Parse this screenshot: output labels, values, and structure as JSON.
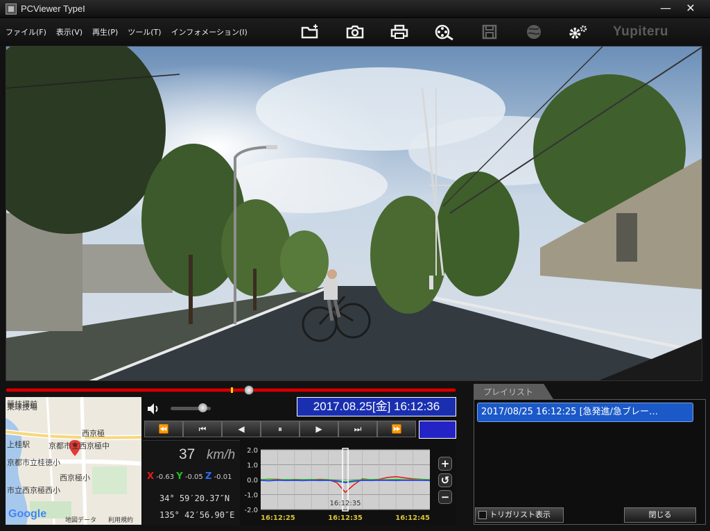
{
  "window": {
    "title": "PCViewer TypeI",
    "minimize_label": "—",
    "close_label": "✕"
  },
  "menu": [
    {
      "label": "ファイル(F)"
    },
    {
      "label": "表示(V)"
    },
    {
      "label": "再生(P)"
    },
    {
      "label": "ツール(T)"
    },
    {
      "label": "インフォメーション(I)"
    }
  ],
  "toolbar": {
    "icons": [
      "folder-icon",
      "camera-icon",
      "print-icon",
      "film-search-icon",
      "save-icon",
      "globe-icon",
      "settings-icon"
    ],
    "brand": "Yupiteru"
  },
  "seek": {
    "progress": 0.54,
    "marker": 0.5
  },
  "volume": {
    "level": 0.8
  },
  "datetime": "2017.08.25[金] 16:12:36",
  "playback_buttons": [
    "⏪",
    "⏮",
    "◀",
    "⏸",
    "▶",
    "⏭",
    "⏩"
  ],
  "colors": {
    "accent_blue": "#1a2fb0",
    "seek_red": "#d40000",
    "playlist_blue": "#1b59c8"
  },
  "map": {
    "labels": [
      "競技場前",
      "東球技場",
      "西京極",
      "上桂駅",
      "京都市立西京極中",
      "京都市立桂徳小",
      "西京極小",
      "市立西京極西小",
      "地図データ",
      "利用規約"
    ],
    "attribution": "Google"
  },
  "info": {
    "speed": "37",
    "speed_unit": "km/h",
    "x_label": "X",
    "x_value": "-0.63",
    "y_label": "Y",
    "y_value": "-0.05",
    "z_label": "Z",
    "z_value": "-0.01",
    "latitude": "34° 59′20.37″N",
    "longitude": "135° 42′56.90″E"
  },
  "chart_data": {
    "type": "line",
    "title": "",
    "xlabel": "",
    "ylabel": "",
    "ylim": [
      -2.0,
      2.0
    ],
    "yticks": [
      "2.0",
      "1.0",
      "0.0",
      "-1.0",
      "-2.0"
    ],
    "xticks": [
      "16:12:25",
      "16:12:35",
      "16:12:45"
    ],
    "cursor_label": "16:12:35",
    "x": [
      0,
      5,
      10,
      15,
      20,
      25,
      30,
      35,
      40,
      45,
      50,
      55,
      60,
      65,
      70,
      75,
      80,
      85,
      90,
      95,
      100
    ],
    "series": [
      {
        "color": "#e41b1b",
        "values": [
          0.0,
          0.03,
          0.02,
          -0.02,
          0.01,
          0.0,
          -0.01,
          0.02,
          0.0,
          -0.2,
          -0.85,
          -0.35,
          0.05,
          0.0,
          0.02,
          0.15,
          0.2,
          0.12,
          0.05,
          0.02,
          0.0
        ]
      },
      {
        "color": "#21c021",
        "values": [
          0.0,
          0.02,
          -0.02,
          0.01,
          -0.01,
          0.0,
          0.01,
          -0.02,
          0.0,
          -0.05,
          -0.15,
          -0.05,
          0.0,
          0.01,
          -0.01,
          0.0,
          0.02,
          -0.01,
          0.0,
          0.01,
          0.0
        ]
      },
      {
        "color": "#2a3ef2",
        "values": [
          -0.05,
          -0.08,
          -0.04,
          -0.06,
          -0.05,
          -0.07,
          -0.04,
          -0.06,
          -0.05,
          -0.1,
          -0.2,
          -0.12,
          -0.05,
          -0.06,
          -0.04,
          -0.05,
          -0.06,
          -0.04,
          -0.05,
          -0.05,
          -0.06
        ]
      }
    ],
    "grid": true
  },
  "graph_buttons": [
    "+",
    "↺",
    "−"
  ],
  "playlist": {
    "tab_label": "プレイリスト",
    "items": [
      "2017/08/25 16:12:25 [急発進/急ブレー…"
    ],
    "trigger_list_label": "トリガリスト表示",
    "close_label": "閉じる"
  }
}
